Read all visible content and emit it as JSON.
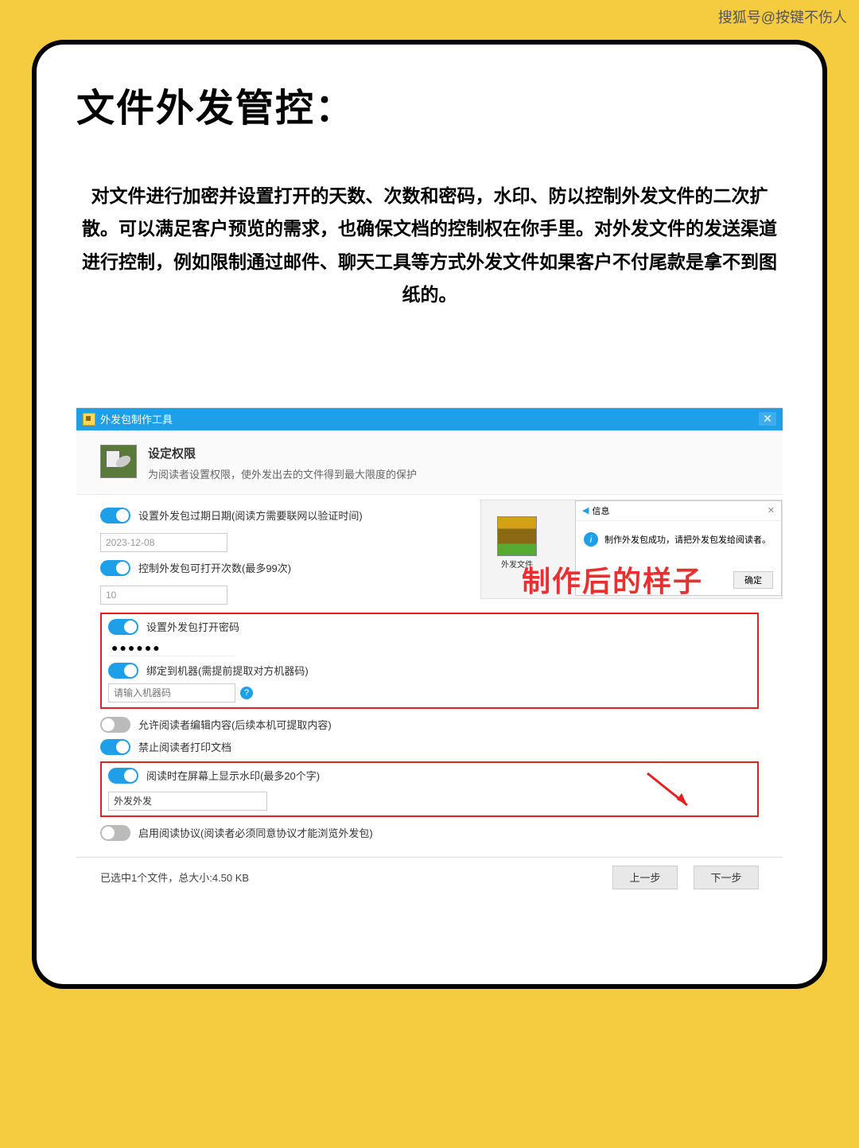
{
  "watermark": "搜狐号@按键不伤人",
  "main_title": "文件外发管控：",
  "description": "对文件进行加密并设置打开的天数、次数和密码，水印、防以控制外发文件的二次扩散。可以满足客户预览的需求，也确保文档的控制权在你手里。对外发文件的发送渠道进行控制，例如限制通过邮件、聊天工具等方式外发文件如果客户不付尾款是拿不到图纸的。",
  "window": {
    "title": "外发包制作工具",
    "header_title": "设定权限",
    "header_subtitle": "为阅读者设置权限，使外发出去的文件得到最大限度的保护",
    "rows": {
      "expire": "设置外发包过期日期(阅读方需要联网以验证时间)",
      "expire_value": "2023-12-08",
      "open_times": "控制外发包可打开次数(最多99次)",
      "open_times_value": "10",
      "password": "设置外发包打开密码",
      "password_value": "●●●●●●",
      "bind_machine": "绑定到机器(需提前提取对方机器码)",
      "bind_machine_placeholder": "请输入机器码",
      "allow_edit": "允许阅读者编辑内容(后续本机可提取内容)",
      "no_print": "禁止阅读者打印文档",
      "watermark": "阅读时在屏幕上显示水印(最多20个字)",
      "watermark_value": "外发外发",
      "protocol": "启用阅读协议(阅读者必须同意协议才能浏览外发包)"
    },
    "status": "已选中1个文件，总大小:4.50 KB",
    "prev_btn": "上一步",
    "next_btn": "下一步"
  },
  "overlay_text": "制作后的样子",
  "preview": {
    "file_label": "外发文件",
    "dialog_title": "信息",
    "dialog_message": "制作外发包成功，请把外发包发给阅读者。",
    "dialog_ok": "确定"
  }
}
